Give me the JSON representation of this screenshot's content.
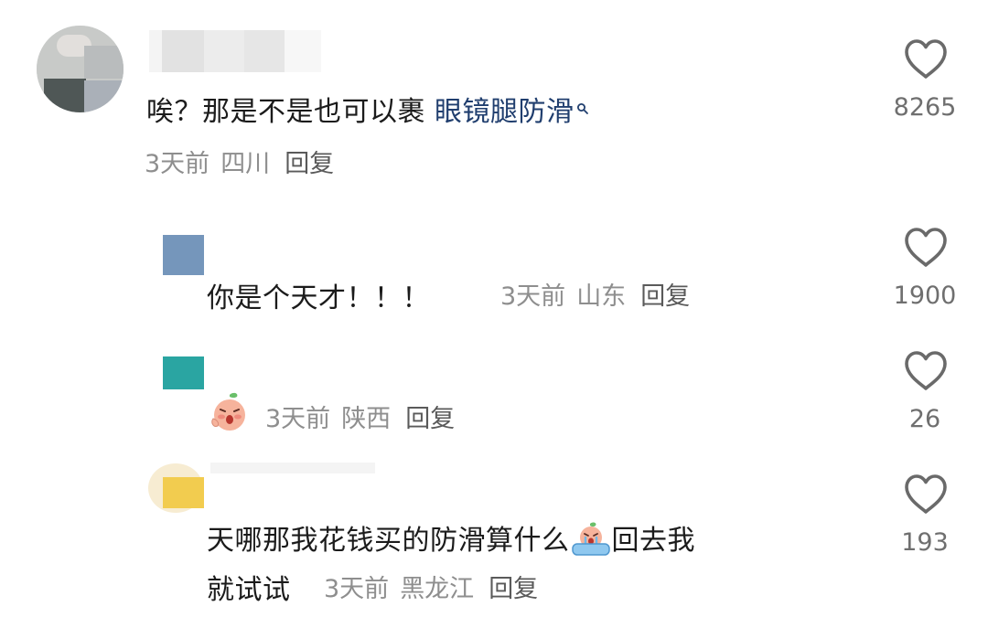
{
  "comment": {
    "text_prefix": "唉？那是不是也可以裹 ",
    "link_text": "眼镜腿防滑",
    "time": "3天前",
    "location": "四川",
    "reply_label": "回复",
    "like_count": "8265"
  },
  "replies": [
    {
      "avatar_color": "#7596bb",
      "text": "你是个天才！！！",
      "time": "3天前",
      "location": "山东",
      "reply_label": "回复",
      "like_count": "1900"
    },
    {
      "avatar_color": "#2aa5a2",
      "sticker": "crying-peach-sticker",
      "time": "3天前",
      "location": "陕西",
      "reply_label": "回复",
      "like_count": "26"
    },
    {
      "avatar_color": "#f2cc4f",
      "text_line1_a": "天哪那我花钱买的防滑算什么",
      "text_line1_b": "回去我",
      "text_line2": "就试试",
      "sticker": "crying-peach-bath-sticker",
      "time": "3天前",
      "location": "黑龙江",
      "reply_label": "回复",
      "like_count": "193"
    }
  ],
  "icons": {
    "like": "heart-outline-icon",
    "search": "search-icon"
  }
}
